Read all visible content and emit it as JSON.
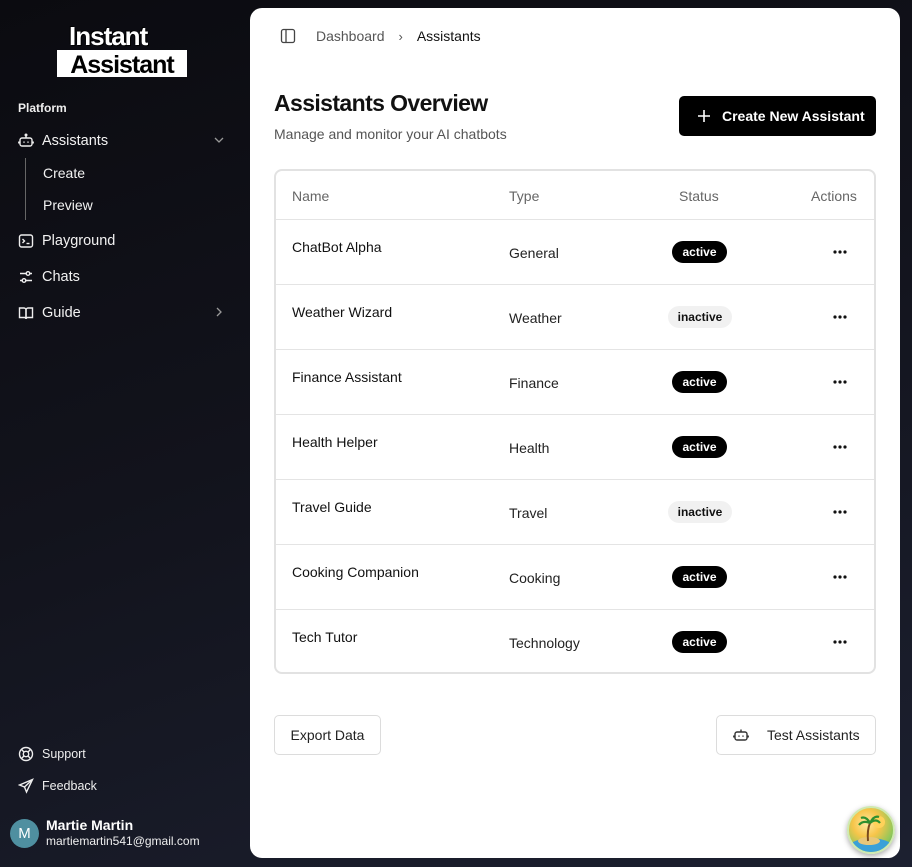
{
  "brand": {
    "line1": "Instant",
    "line2": "Assistant"
  },
  "sidebar": {
    "section_label": "Platform",
    "items": [
      {
        "label": "Assistants",
        "icon": "bot-icon",
        "expanded": true,
        "children": [
          {
            "label": "Create"
          },
          {
            "label": "Preview"
          }
        ]
      },
      {
        "label": "Playground",
        "icon": "terminal-icon"
      },
      {
        "label": "Chats",
        "icon": "sliders-icon"
      },
      {
        "label": "Guide",
        "icon": "book-icon"
      }
    ],
    "footer": [
      {
        "label": "Support",
        "icon": "life-buoy-icon"
      },
      {
        "label": "Feedback",
        "icon": "send-icon"
      }
    ],
    "user": {
      "initial": "M",
      "name": "Martie Martin",
      "email": "martiemartin541@gmail.com"
    }
  },
  "breadcrumb": {
    "parent": "Dashboard",
    "current": "Assistants"
  },
  "page": {
    "title": "Assistants Overview",
    "subtitle": "Manage and monitor your AI chatbots",
    "create_button": "Create New Assistant"
  },
  "table": {
    "columns": [
      "Name",
      "Type",
      "Status",
      "Actions"
    ],
    "rows": [
      {
        "name": "ChatBot Alpha",
        "type": "General",
        "status": "active"
      },
      {
        "name": "Weather Wizard",
        "type": "Weather",
        "status": "inactive"
      },
      {
        "name": "Finance Assistant",
        "type": "Finance",
        "status": "active"
      },
      {
        "name": "Health Helper",
        "type": "Health",
        "status": "active"
      },
      {
        "name": "Travel Guide",
        "type": "Travel",
        "status": "inactive"
      },
      {
        "name": "Cooking Companion",
        "type": "Cooking",
        "status": "active"
      },
      {
        "name": "Tech Tutor",
        "type": "Technology",
        "status": "active"
      }
    ]
  },
  "actions": {
    "export": "Export Data",
    "test": "Test Assistants"
  }
}
